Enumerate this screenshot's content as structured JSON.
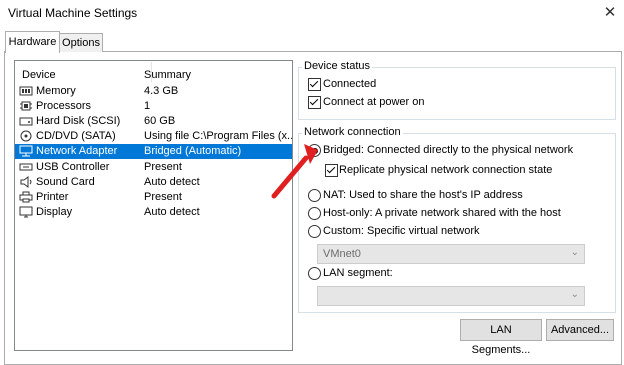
{
  "window": {
    "title": "Virtual Machine Settings",
    "close_glyph": "✕"
  },
  "tabs": [
    {
      "label": "Hardware"
    },
    {
      "label": "Options"
    }
  ],
  "device_list": {
    "col_device": "Device",
    "col_summary": "Summary",
    "rows": [
      {
        "name": "Memory",
        "summary": "4.3 GB",
        "icon": "memory-icon"
      },
      {
        "name": "Processors",
        "summary": "1",
        "icon": "processor-icon"
      },
      {
        "name": "Hard Disk (SCSI)",
        "summary": "60 GB",
        "icon": "hard-disk-icon"
      },
      {
        "name": "CD/DVD (SATA)",
        "summary": "Using file C:\\Program Files (x...",
        "icon": "cd-dvd-icon"
      },
      {
        "name": "Network Adapter",
        "summary": "Bridged (Automatic)",
        "icon": "network-adapter-icon",
        "selected": true
      },
      {
        "name": "USB Controller",
        "summary": "Present",
        "icon": "usb-icon"
      },
      {
        "name": "Sound Card",
        "summary": "Auto detect",
        "icon": "sound-card-icon"
      },
      {
        "name": "Printer",
        "summary": "Present",
        "icon": "printer-icon"
      },
      {
        "name": "Display",
        "summary": "Auto detect",
        "icon": "display-icon"
      }
    ]
  },
  "device_status": {
    "legend": "Device status",
    "connected": "Connected",
    "connect_at_power_on": "Connect at power on"
  },
  "network_connection": {
    "legend": "Network connection",
    "bridged": "Bridged: Connected directly to the physical network",
    "replicate": "Replicate physical network connection state",
    "nat": "NAT: Used to share the host's IP address",
    "host_only": "Host-only: A private network shared with the host",
    "custom": "Custom: Specific virtual network",
    "custom_value": "VMnet0",
    "lan_segment": "LAN segment:",
    "lan_value": ""
  },
  "buttons": {
    "lan_segments": "LAN Segments...",
    "advanced": "Advanced..."
  },
  "colors": {
    "selection": "#0078d7",
    "arrow": "#e02020"
  }
}
